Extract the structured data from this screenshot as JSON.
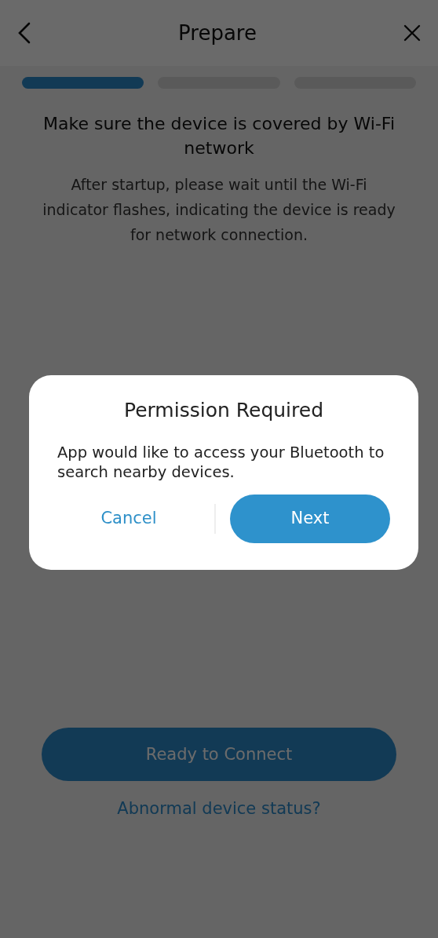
{
  "header": {
    "title": "Prepare"
  },
  "steps": [
    {
      "active": true
    },
    {
      "active": false
    },
    {
      "active": false
    }
  ],
  "heading": "Make sure the device is covered by Wi-Fi network",
  "description": "After startup, please wait until the Wi-Fi indicator flashes, indicating the device is ready for network connection.",
  "primary_button": {
    "label": "Ready to Connect"
  },
  "help_link": "Abnormal device status?",
  "dialog": {
    "title": "Permission Required",
    "message": "App would like to access your Bluetooth to search nearby devices.",
    "cancel": "Cancel",
    "confirm": "Next"
  }
}
